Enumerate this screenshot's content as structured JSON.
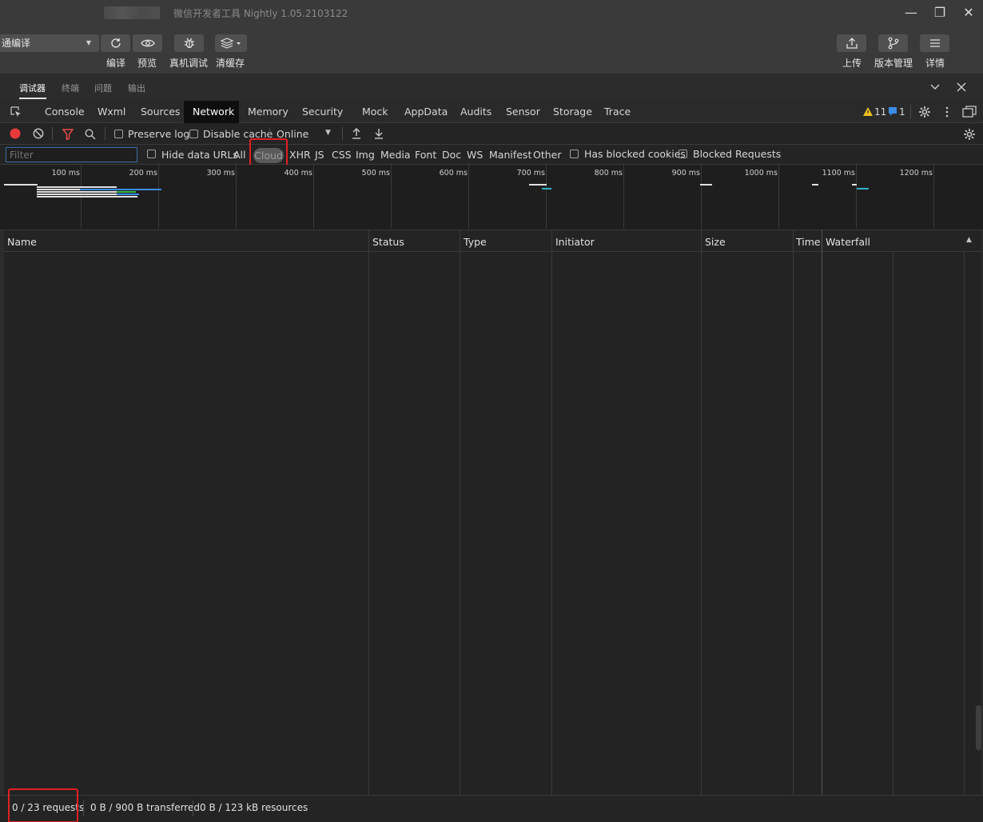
{
  "window": {
    "app_title": "微信开发者工具 Nightly 1.05.2103122",
    "minimize_glyph": "—",
    "maximize_glyph": "❐",
    "close_glyph": "✕"
  },
  "toolbar": {
    "compile_mode": "通编译",
    "compile_label": "编译",
    "preview_label": "预览",
    "remote_debug_label": "真机调试",
    "clear_cache_label": "清缓存",
    "upload_label": "上传",
    "version_label": "版本管理",
    "details_label": "详情"
  },
  "debug_tabs": [
    "调试器",
    "终端",
    "问题",
    "输出"
  ],
  "devtools_tabs": [
    "Console",
    "Wxml",
    "Sources",
    "Network",
    "Memory",
    "Security",
    "Mock",
    "AppData",
    "Audits",
    "Sensor",
    "Storage",
    "Trace"
  ],
  "devtools_active_tab": "Network",
  "badges": {
    "warnings": "11",
    "info": "1"
  },
  "net_toolbar": {
    "preserve_log": "Preserve log",
    "disable_cache": "Disable cache",
    "throttling": "Online"
  },
  "filter": {
    "placeholder": "Filter",
    "hide_data_urls": "Hide data URLs",
    "types": [
      "All",
      "Cloud",
      "XHR",
      "JS",
      "CSS",
      "Img",
      "Media",
      "Font",
      "Doc",
      "WS",
      "Manifest",
      "Other"
    ],
    "has_blocked_cookies": "Has blocked cookies",
    "blocked_requests": "Blocked Requests"
  },
  "overview": {
    "ticks": [
      "100 ms",
      "200 ms",
      "300 ms",
      "400 ms",
      "500 ms",
      "600 ms",
      "700 ms",
      "800 ms",
      "900 ms",
      "1000 ms",
      "1100 ms",
      "1200 ms"
    ]
  },
  "table": {
    "columns": [
      "Name",
      "Status",
      "Type",
      "Initiator",
      "Size",
      "Time",
      "Waterfall"
    ],
    "sort_glyph": "▲"
  },
  "status": {
    "requests": "0 / 23 requests",
    "transferred": "0 B / 900 B transferred",
    "resources": "0 B / 123 kB resources"
  },
  "colors": {
    "highlight_box": "#e02020",
    "record_button": "#e83a3a",
    "filter_icon": "#e84a4a",
    "active_tab_bg": "#0e0e0e"
  }
}
